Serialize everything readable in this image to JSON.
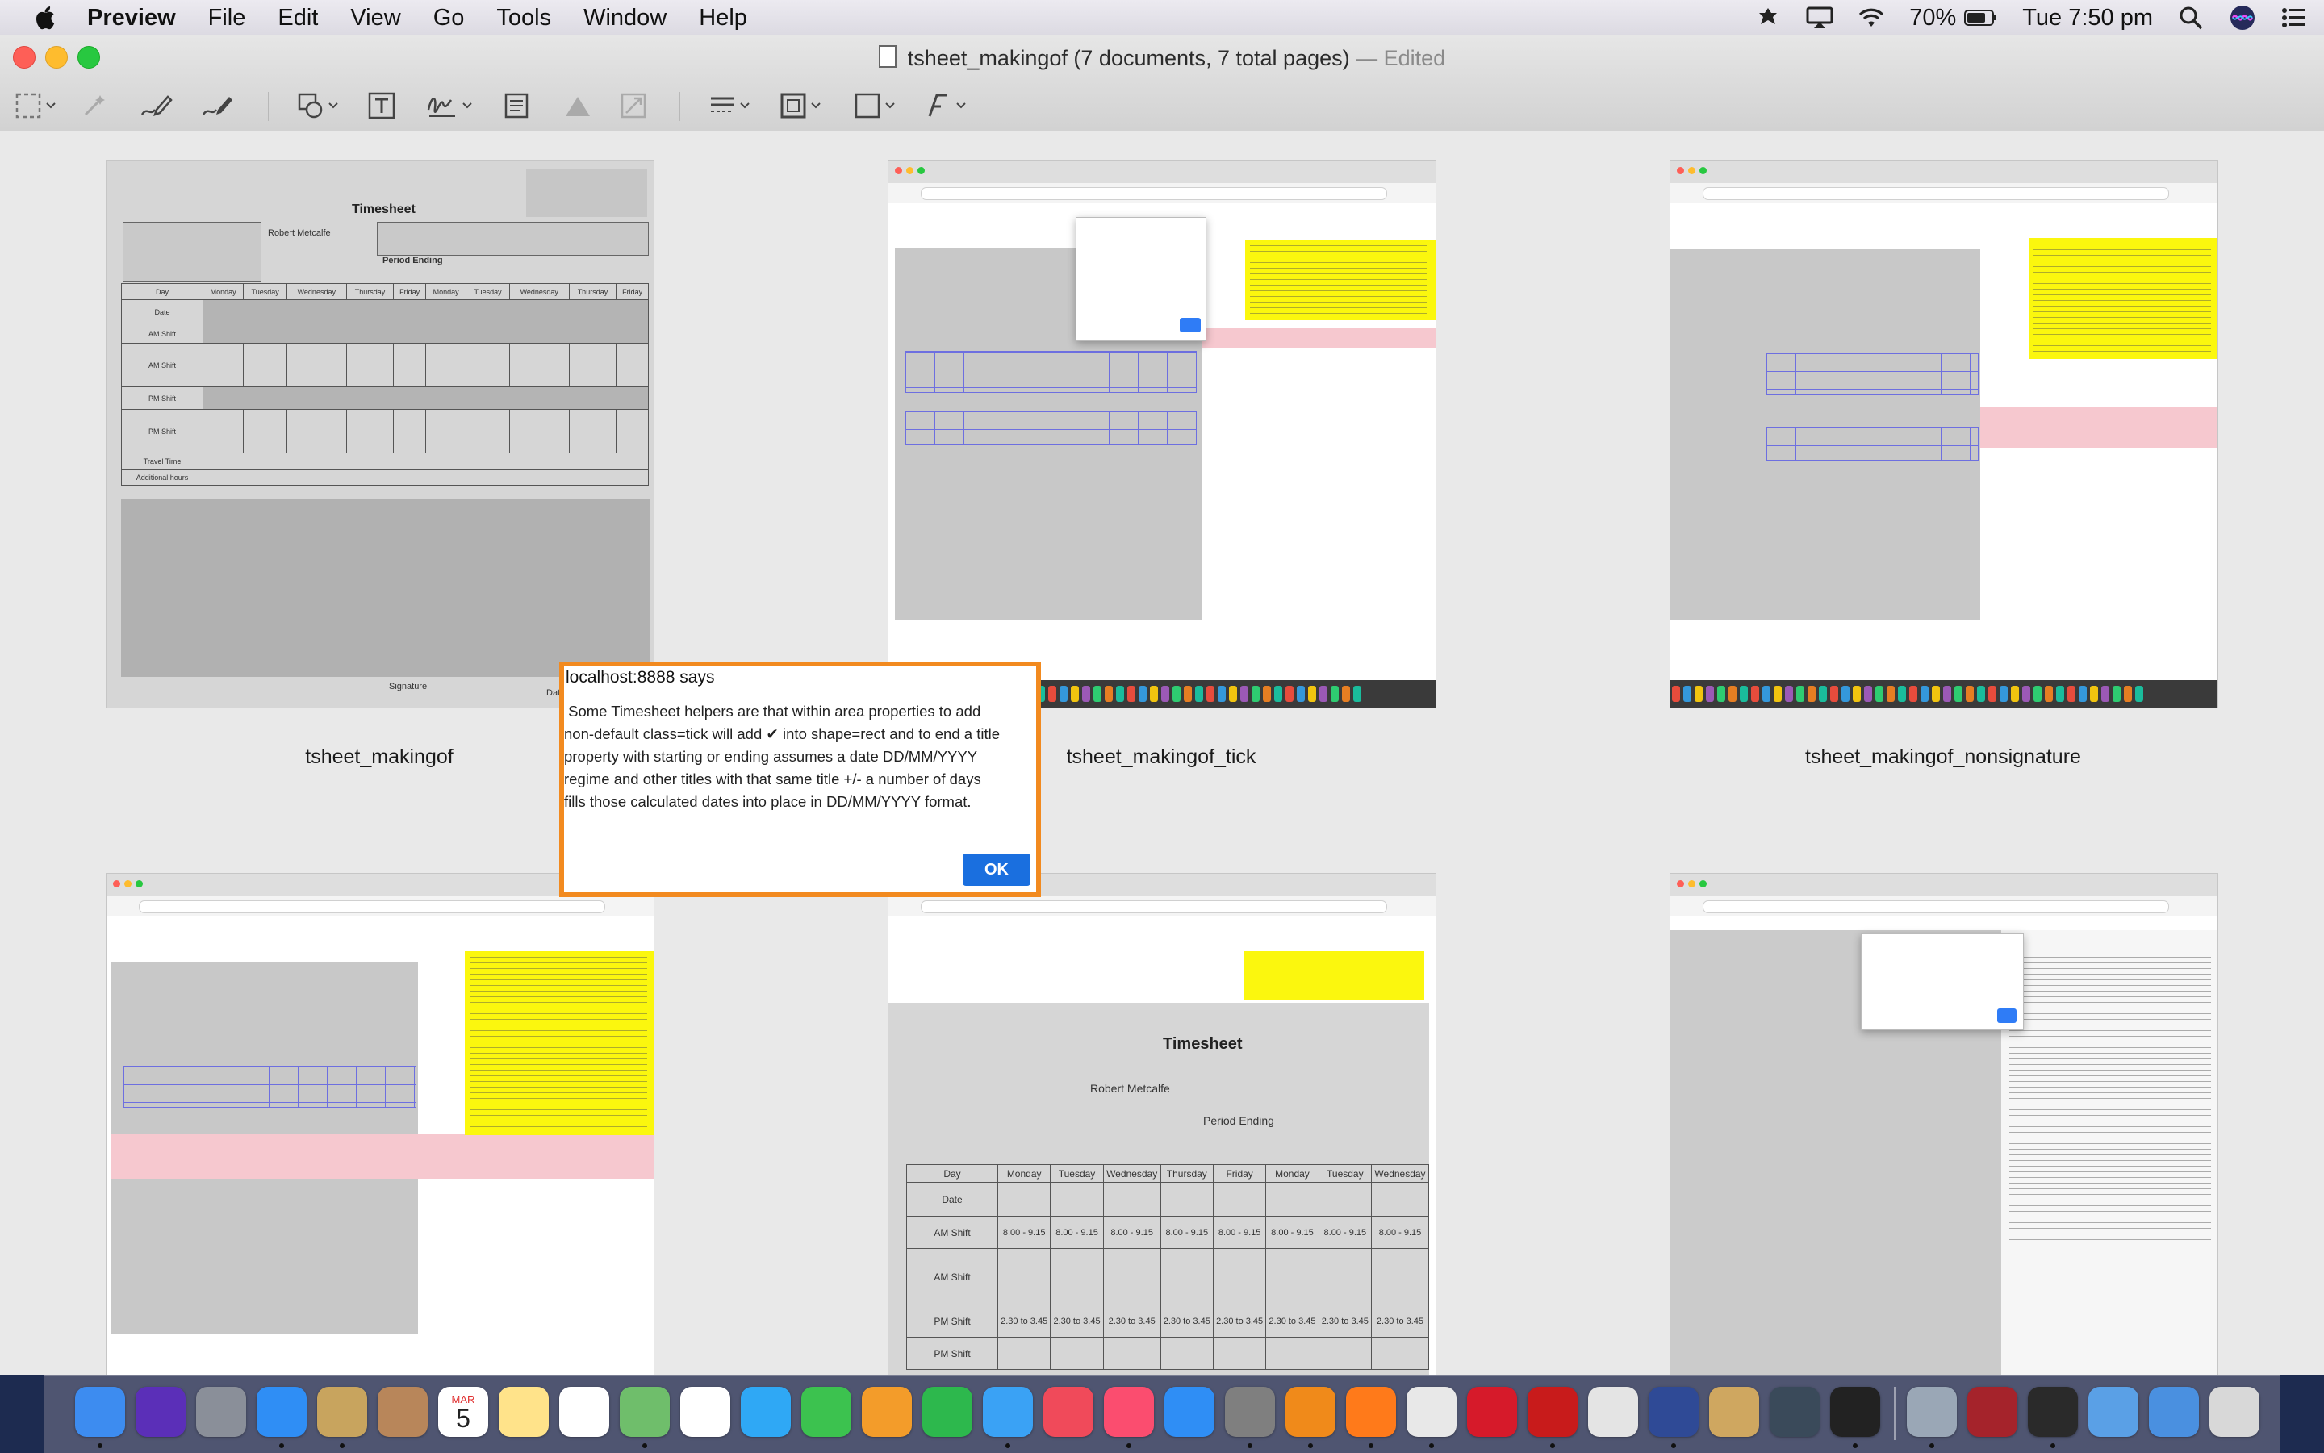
{
  "menubar": {
    "app_name": "Preview",
    "menus": [
      "File",
      "Edit",
      "View",
      "Go",
      "Tools",
      "Window",
      "Help"
    ],
    "battery": "70%",
    "clock": "Tue 7:50 pm",
    "status_icons": [
      "bluetooth-app-icon",
      "airplay-icon",
      "wifi-icon",
      "battery-icon",
      "spotlight-icon",
      "siri-icon",
      "notification-center-icon"
    ]
  },
  "window": {
    "title": "tsheet_makingof (7 documents, 7 total pages)",
    "edited": " — Edited"
  },
  "toolbar": {
    "tools": [
      "selection-tool-icon",
      "instant-alpha-icon",
      "sketch-icon",
      "draw-icon",
      "shapes-icon",
      "text-icon",
      "sign-icon",
      "note-icon",
      "adjust-color-icon",
      "adjust-size-icon",
      "shape-style-icon",
      "border-color-icon",
      "fill-color-icon",
      "text-style-icon"
    ]
  },
  "thumbnails": [
    {
      "caption": "tsheet_makingof"
    },
    {
      "caption": "tsheet_makingof_tick"
    },
    {
      "caption": "tsheet_makingof_nonsignature"
    }
  ],
  "scan": {
    "sheet_title": "Timesheet",
    "employee": "Robert Metcalfe",
    "period_label": "Period Ending",
    "days": [
      "Monday",
      "Tuesday",
      "Wednesday",
      "Thursday",
      "Friday",
      "Monday",
      "Tuesday",
      "Wednesday",
      "Thursday",
      "Friday"
    ],
    "rows": [
      "Day",
      "Date",
      "AM Shift",
      "AM Shift",
      "PM Shift",
      "PM Shift",
      "Travel Time",
      "Additional hours"
    ],
    "am_times": "8.00 - 9.15",
    "pm_times": "2.30 to 3.45",
    "signature_label": "Signature",
    "date_label": "Date"
  },
  "alert": {
    "title": "localhost:8888 says",
    "message": " Some Timesheet helpers are that within area properties to add\nnon-default class=tick will add ✔ into shape=rect and to end a title\nproperty with starting or ending assumes a date DD/MM/YYYY\nregime and other titles with that same title +/- a number of days\nfills those calculated dates into place in DD/MM/YYYY format.",
    "ok_label": "OK"
  },
  "dock": {
    "apps": [
      "finder-icon",
      "siri-icon",
      "launchpad-icon",
      "safari-icon",
      "preview-icon",
      "notefile-icon",
      "calendar-icon",
      "notes-icon",
      "reminders-icon",
      "maps-icon",
      "photos-icon",
      "messages-icon",
      "facetime-icon",
      "pages-icon",
      "numbers-icon",
      "keynote-icon",
      "news-icon",
      "music-icon",
      "app-store-icon",
      "system-preferences-icon",
      "vlc-icon",
      "firefox-icon",
      "chrome-icon",
      "opera-icon",
      "filezilla-icon",
      "mamp-icon",
      "wordpress-icon",
      "tools-icon",
      "grapher-icon",
      "terminal-icon",
      "image-capture-icon",
      "dictionary-icon",
      "console-icon",
      "documents-folder-icon",
      "downloads-folder-icon",
      "trash-icon"
    ],
    "calendar_month": "MAR",
    "calendar_day": "5"
  },
  "colors": {
    "accent_orange": "#f28a1f",
    "ok_blue": "#1a6fdf"
  }
}
